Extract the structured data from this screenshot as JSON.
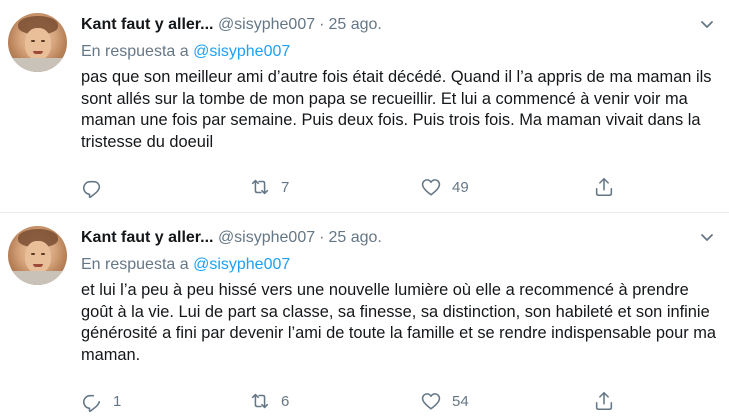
{
  "tweets": [
    {
      "name": "Kant faut y aller...",
      "handle": "@sisyphe007",
      "separator": "·",
      "time": "25 ago.",
      "reply_prefix": "En respuesta a",
      "reply_mention": "@sisyphe007",
      "text": "pas que son meilleur ami d’autre fois était décédé. Quand il l’a appris de ma maman ils sont allés sur la tombe de mon papa se recueillir. Et lui a commencé à venir voir ma maman une fois par semaine. Puis deux fois. Puis trois fois. Ma maman vivait dans la tristesse du doeuil",
      "reply_count": "",
      "retweet_count": "7",
      "like_count": "49"
    },
    {
      "name": "Kant faut y aller...",
      "handle": "@sisyphe007",
      "separator": "·",
      "time": "25 ago.",
      "reply_prefix": "En respuesta a",
      "reply_mention": "@sisyphe007",
      "text": "et lui l’a peu à peu hissé vers une nouvelle lumière où elle a recommencé à prendre goût à la vie. Lui de part sa classe, sa finesse, sa distinction, son habileté et son infinie générosité a fini par devenir l’ami de toute la famille et se rendre indispensable pour ma maman.",
      "reply_count": "1",
      "retweet_count": "6",
      "like_count": "54"
    }
  ],
  "icons": {
    "reply": "reply-icon",
    "retweet": "retweet-icon",
    "like": "heart-icon",
    "share": "share-icon",
    "caret": "chevron-down-icon"
  },
  "colors": {
    "text": "#14171a",
    "muted": "#657786",
    "link": "#1da1f2",
    "divider": "#e6ecf0"
  }
}
